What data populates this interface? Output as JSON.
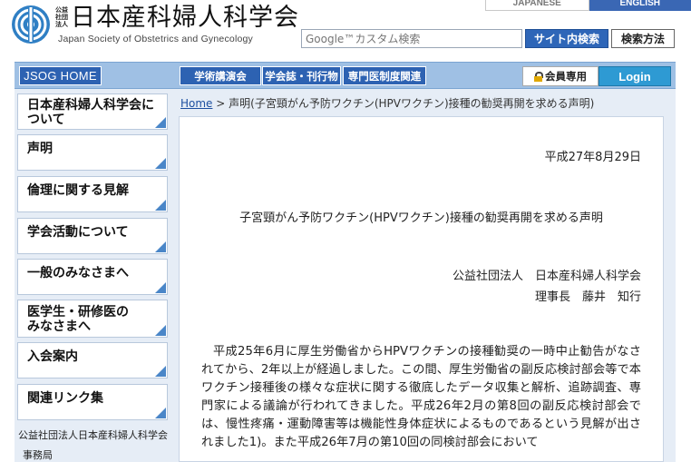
{
  "lang": {
    "japanese": "JAPANESE",
    "english": "ENGLISH"
  },
  "logo": {
    "small_lines": [
      "公益",
      "社団",
      "法人"
    ],
    "title": "日本産科婦人科学会",
    "subtitle": "Japan Society of Obstetrics and Gynecology"
  },
  "search": {
    "placeholder": "Google™カスタム検索",
    "button": "サイト内検索",
    "howto": "検索方法"
  },
  "nav": {
    "home": "JSOG HOME",
    "items": [
      "学術講演会",
      "学会誌・刊行物",
      "専門医制度関連"
    ],
    "members": "会員専用",
    "login": "Login"
  },
  "sidebar": {
    "items": [
      "日本産科婦人科学会について",
      "声明",
      "倫理に関する見解",
      "学会活動について",
      "一般のみなさまへ",
      "医学生・研修医のみなさまへ",
      "入会案内",
      "関連リンク集"
    ],
    "footer_org": "公益社団法人日本産科婦人科学会",
    "footer_office": "事務局"
  },
  "breadcrumb": {
    "home": "Home",
    "sep": ">",
    "current": "声明(子宮頸がん予防ワクチン(HPVワクチン)接種の勧奨再開を求める声明)"
  },
  "article": {
    "date": "平成27年8月29日",
    "title": "子宮頸がん予防ワクチン(HPVワクチン)接種の勧奨再開を求める声明",
    "org": "公益社団法人　日本産科婦人科学会",
    "chair": "理事長　藤井　知行",
    "body": "平成25年6月に厚生労働省からHPVワクチンの接種勧奨の一時中止勧告がなされてから、2年以上が経過しました。この間、厚生労働省の副反応検討部会等で本ワクチン接種後の様々な症状に関する徹底したデータ収集と解析、追跡調査、専門家による議論が行われてきました。平成26年2月の第8回の副反応検討部会では、慢性疼痛・運動障害等は機能性身体症状によるものであるという見解が出されました1)。また平成26年7月の第10回の同検討部会において"
  },
  "colors": {
    "accent": "#2d62b2",
    "nav_bg": "#9fc0e4",
    "panel_bg": "#e6edf6"
  }
}
